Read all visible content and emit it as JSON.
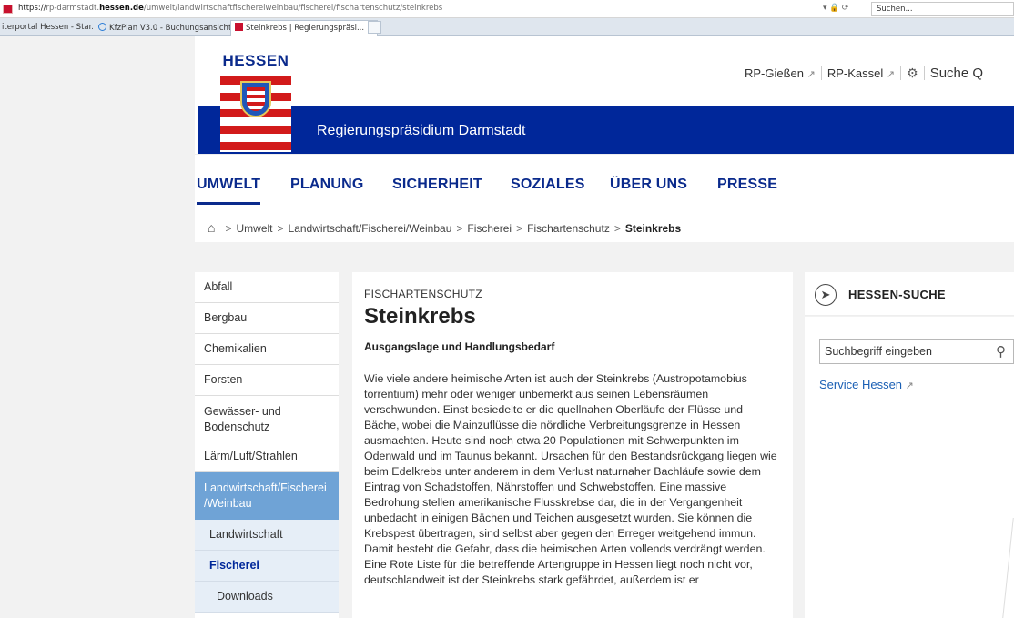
{
  "browser": {
    "url_prefix": "https://",
    "url_sub": "rp-darmstadt.",
    "url_domain": "hessen.de",
    "url_path": "/umwelt/landwirtschaftfischereiweinbau/fischerei/fischartenschutz/steinkrebs",
    "controls": "▾ 🔒 ⟳",
    "search_placeholder": "Suchen...",
    "tabs": [
      {
        "label": "iterportal Hessen - Star...",
        "icon": "page-icon"
      },
      {
        "label": "KfzPlan V3.0 - Buchungsansicht",
        "icon": "ie-icon"
      },
      {
        "label": "Steinkrebs | Regierungspräsi...",
        "icon": "hessen-icon",
        "close": "×"
      }
    ]
  },
  "header": {
    "logo_text": "HESSEN",
    "banner_title": "Regierungspräsidium Darmstadt",
    "toplinks": [
      {
        "label": "RP-Gießen",
        "ext": "↗"
      },
      {
        "label": "RP-Kassel",
        "ext": "↗"
      }
    ],
    "settings_icon": "gear-icon",
    "search_label": "Suche",
    "search_glyph": "Q"
  },
  "nav": {
    "items": [
      {
        "label": "UMWELT"
      },
      {
        "label": "PLANUNG"
      },
      {
        "label": "SICHERHEIT"
      },
      {
        "label": "SOZIALES"
      },
      {
        "label": "ÜBER UNS"
      },
      {
        "label": "PRESSE"
      }
    ]
  },
  "breadcrumb": {
    "home_glyph": "⌂",
    "sep": ">",
    "items": [
      "Umwelt",
      "Landwirtschaft/Fischerei/Weinbau",
      "Fischerei",
      "Fischartenschutz"
    ],
    "current": "Steinkrebs"
  },
  "sidebar": {
    "items": [
      "Abfall",
      "Bergbau",
      "Chemikalien",
      "Forsten",
      "Gewässer- und Bodenschutz",
      "Lärm/Luft/Strahlen",
      "Landwirtschaft/Fischerei /Weinbau",
      "Landwirtschaft",
      "Fischerei",
      "Downloads"
    ]
  },
  "article": {
    "kicker": "FISCHARTENSCHUTZ",
    "title": "Steinkrebs",
    "subtitle": "Ausgangslage und Handlungsbedarf",
    "body": "Wie viele andere heimische Arten ist auch der Steinkrebs (Austropotamobius torrentium) mehr oder weniger unbemerkt aus seinen Lebensräumen verschwunden. Einst besiedelte er die quellnahen Oberläufe der Flüsse und Bäche, wobei die Mainzuflüsse die nördliche Verbreitungsgrenze in Hessen ausmachten. Heute sind noch etwa 20 Populationen mit Schwerpunkten im Odenwald und im Taunus bekannt. Ursachen für den Bestandsrückgang liegen wie beim Edelkrebs unter anderem in dem Verlust naturnaher Bachläufe sowie dem Eintrag von Schadstoffen, Nährstoffen und Schwebstoffen. Eine massive Bedrohung stellen amerikanische Flusskrebse dar, die in der Vergangenheit unbedacht in einigen Bächen und Teichen ausgesetzt wurden. Sie können die Krebspest übertragen, sind selbst aber gegen den Erreger weitgehend immun. Damit besteht die Gefahr, dass die heimischen Arten vollends verdrängt werden. Eine Rote Liste für die betreffende Artengruppe in Hessen liegt noch nicht vor, deutschlandweit ist der Steinkrebs stark gefährdet, außerdem ist er"
  },
  "rightpanel": {
    "title": "HESSEN-SUCHE",
    "icon_glyph": "➤",
    "search_placeholder": "Suchbegriff eingeben",
    "search_glyph": "⚲",
    "service_label": "Service Hessen",
    "service_ext": "↗"
  },
  "colors": {
    "primary": "#00279a",
    "accent": "#6fa3d6",
    "nav_text": "#0a2a8c",
    "red": "#d21a1a"
  }
}
